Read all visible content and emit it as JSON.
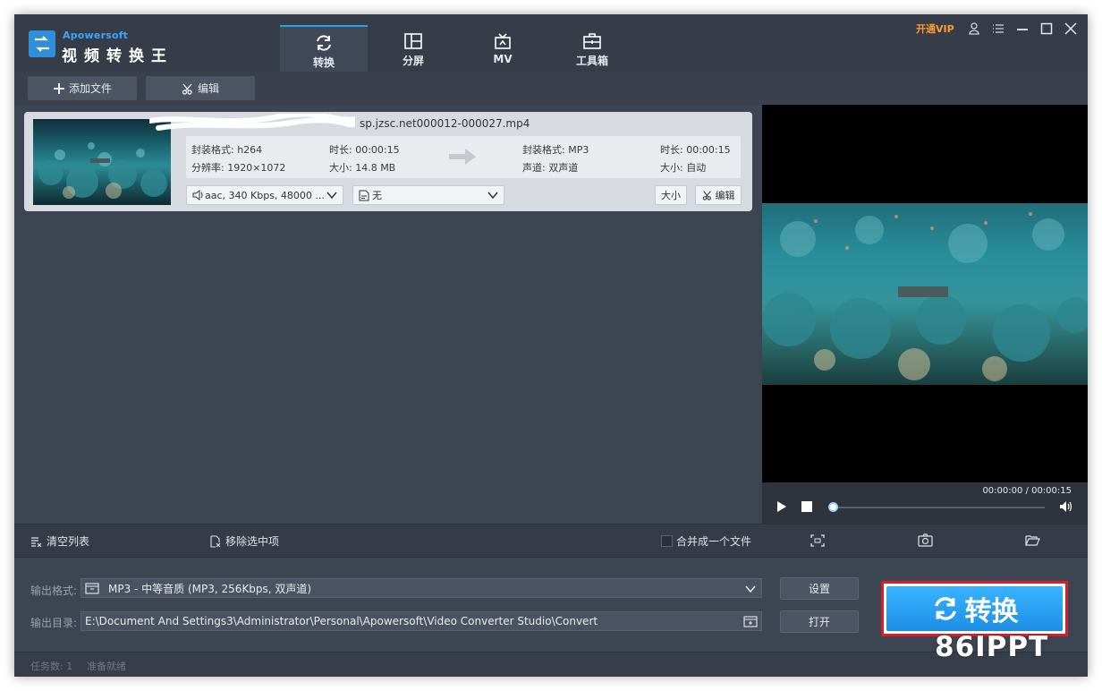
{
  "app": {
    "brand_en": "Apowersoft",
    "brand_cn": "视频转换王",
    "vip_label": "开通VIP"
  },
  "nav_tabs": [
    {
      "label": "转换",
      "icon": "refresh-icon",
      "active": true
    },
    {
      "label": "分屏",
      "icon": "split-screen-icon",
      "active": false
    },
    {
      "label": "MV",
      "icon": "tv-icon",
      "active": false
    },
    {
      "label": "工具箱",
      "icon": "toolbox-icon",
      "active": false
    }
  ],
  "toolbar": {
    "add_file": "添加文件",
    "edit": "编辑"
  },
  "file": {
    "name": "sp.jzsc.net000012-000027.mp4",
    "src": {
      "format": "封装格式: h264",
      "resolution": "分辨率: 1920×1072",
      "duration": "时长: 00:00:15",
      "size": "大小: 14.8 MB"
    },
    "dst": {
      "format": "封装格式: MP3",
      "channel": "声道: 双声道",
      "duration": "时长: 00:00:15",
      "size": "大小: 自动"
    },
    "audio_track": "aac, 340 Kbps, 48000 ...",
    "subtitle": "无",
    "size_btn": "大小",
    "edit_btn": "编辑"
  },
  "player": {
    "timecode": "00:00:00 / 00:00:15",
    "progress": 0
  },
  "list_actions": {
    "clear": "清空列表",
    "remove": "移除选中项",
    "merge": "合并成一个文件"
  },
  "output": {
    "format_label": "输出格式:",
    "format_value": "MP3 - 中等音质 (MP3, 256Kbps, 双声道)",
    "dir_label": "输出目录:",
    "dir_value": "E:\\Document And Settings3\\Administrator\\Personal\\Apowersoft\\Video Converter Studio\\Convert",
    "settings_btn": "设置",
    "open_btn": "打开",
    "convert_btn": "转换"
  },
  "status": {
    "tasks": "任务数: 1",
    "ready": "准备就绪"
  },
  "watermark": "86IPPT",
  "colors": {
    "accent": "#2f9cf0",
    "convert": "#1d8fe6",
    "vip": "#ff9a2e",
    "highlight_border": "#d51f2a"
  }
}
